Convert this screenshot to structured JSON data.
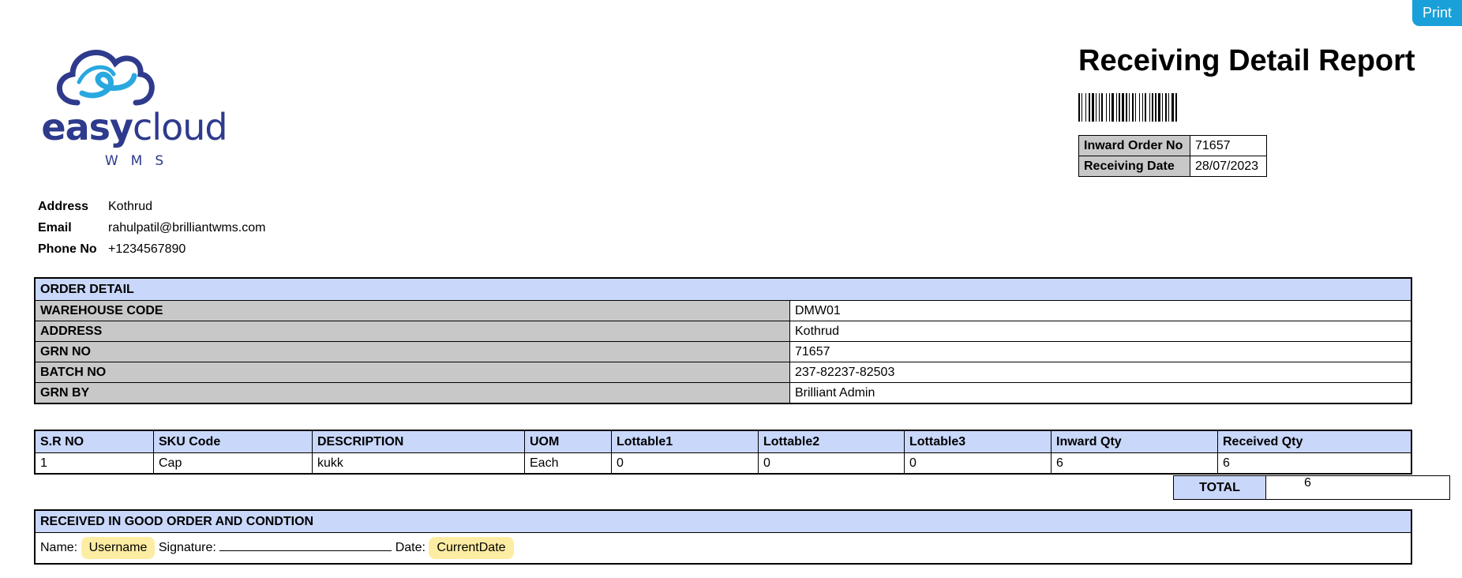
{
  "print_label": "Print",
  "logo": {
    "word_bold": "easy",
    "word_light": "cloud",
    "sub": "WMS",
    "colors": {
      "dark": "#2e3a8c",
      "light": "#29a8e0"
    }
  },
  "contact": [
    {
      "label": "Address",
      "value": "Kothrud"
    },
    {
      "label": "Email",
      "value": "rahulpatil@brilliantwms.com"
    },
    {
      "label": "Phone No",
      "value": "+1234567890"
    }
  ],
  "report": {
    "title": "Receiving Detail Report",
    "inward_order_label": "Inward Order No",
    "inward_order_value": "71657",
    "receiving_date_label": "Receiving Date",
    "receiving_date_value": "28/07/2023"
  },
  "order_detail": {
    "header": "ORDER DETAIL",
    "rows": [
      {
        "label": "WAREHOUSE CODE",
        "value": "DMW01"
      },
      {
        "label": "ADDRESS",
        "value": "Kothrud"
      },
      {
        "label": "GRN NO",
        "value": "71657"
      },
      {
        "label": "BATCH NO",
        "value": "237-82237-82503"
      },
      {
        "label": "GRN BY",
        "value": "Brilliant Admin"
      }
    ]
  },
  "items": {
    "columns": [
      "S.R NO",
      "SKU Code",
      "DESCRIPTION",
      "UOM",
      "Lottable1",
      "Lottable2",
      "Lottable3",
      "Inward Qty",
      "Received Qty"
    ],
    "rows": [
      [
        "1",
        "Cap",
        "kukk",
        "Each",
        "0",
        "0",
        "0",
        "6",
        "6"
      ]
    ]
  },
  "total": {
    "label": "TOTAL",
    "value": "6"
  },
  "receipt": {
    "header": "RECEIVED IN GOOD ORDER AND CONDTION",
    "name_label": "Name:",
    "name_value": "Username",
    "signature_label": "Signature:",
    "date_label": "Date:",
    "date_value": "CurrentDate"
  },
  "colors": {
    "header_blue": "#c9d7fa",
    "label_gray": "#c8c8c8",
    "chip_yellow": "#fdeda2",
    "print_button": "#1aa0d8"
  }
}
